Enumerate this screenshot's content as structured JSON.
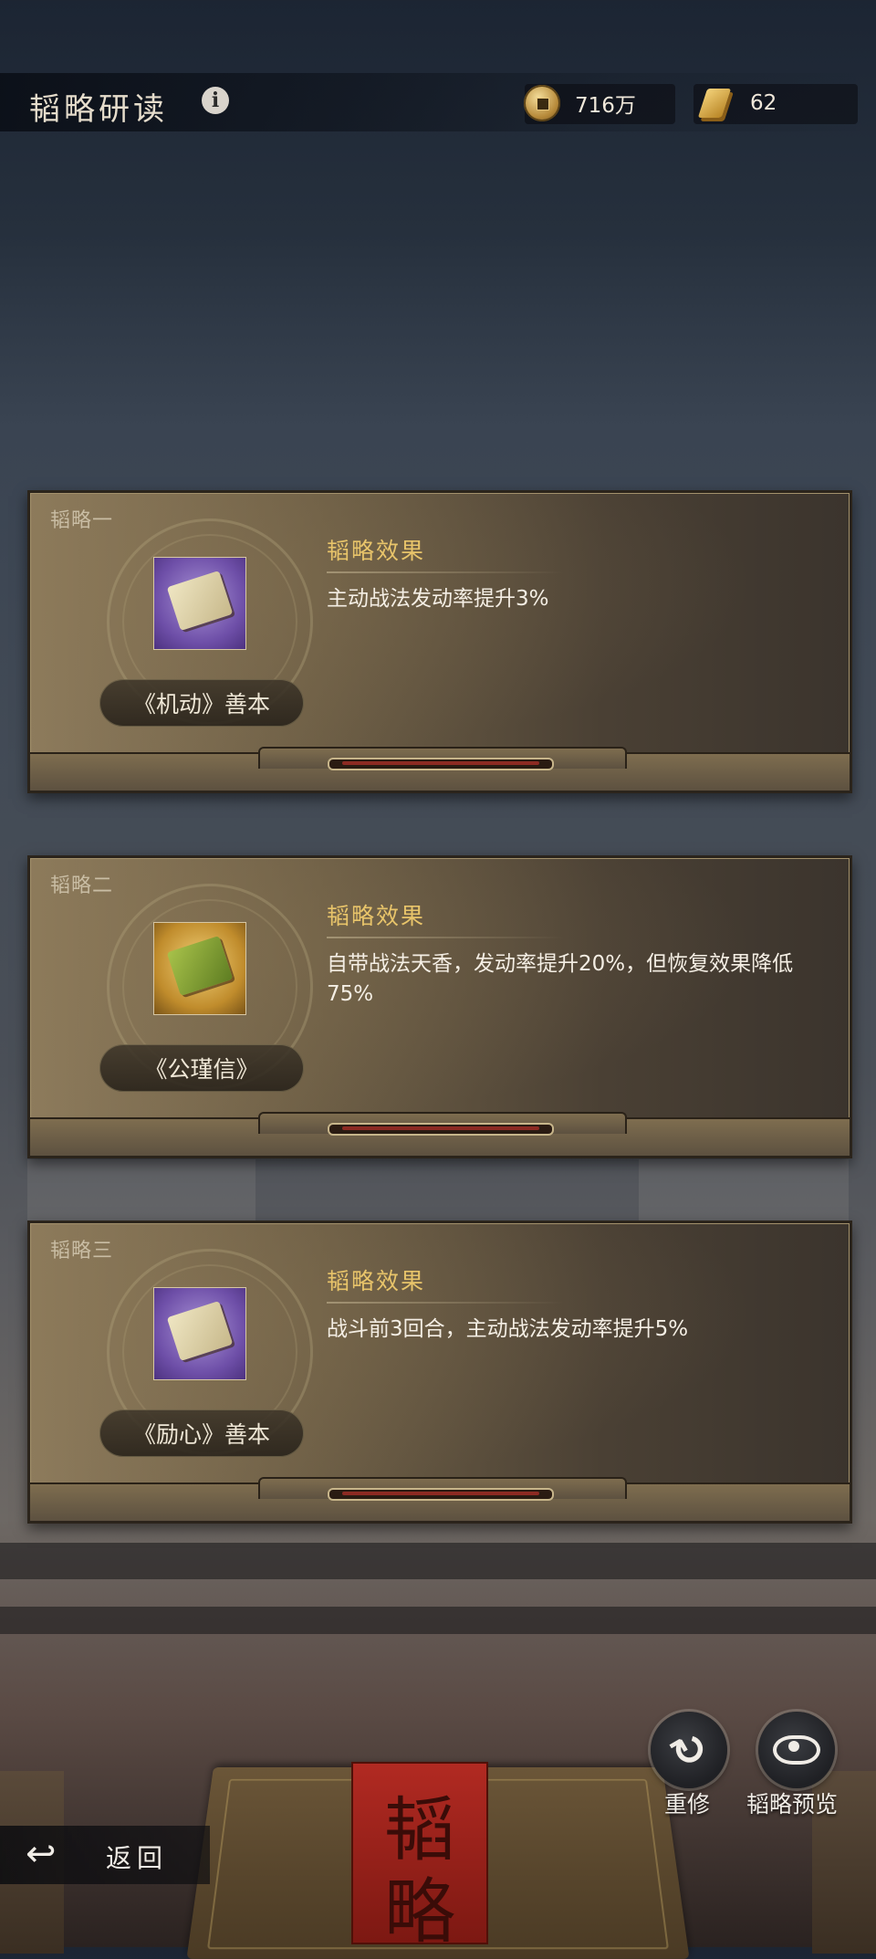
{
  "header": {
    "title": "韬略研读",
    "info_icon": "info-icon"
  },
  "resources": [
    {
      "icon": "coin-icon",
      "value": "716万"
    },
    {
      "icon": "scroll-icon",
      "value": "62"
    }
  ],
  "panels": [
    {
      "tag": "韬略一",
      "item_icon": "scroll-bundle-icon",
      "book_name": "《机动》善本",
      "effect_title": "韬略效果",
      "effect_text": "主动战法发动率提升3%"
    },
    {
      "tag": "韬略二",
      "item_icon": "green-letter-bundle-icon",
      "book_name": "《公瑾信》",
      "effect_title": "韬略效果",
      "effect_text": "自带战法天香，发动率提升20%，但恢复效果降低75%"
    },
    {
      "tag": "韬略三",
      "item_icon": "tied-scrolls-icon",
      "book_name": "《励心》善本",
      "effect_title": "韬略效果",
      "effect_text": "战斗前3回合，主动战法发动率提升5%"
    }
  ],
  "actions": {
    "retrain_label": "重修",
    "preview_label": "韬略预览"
  },
  "book_glyph": "韬略",
  "back": {
    "label": "返回"
  }
}
